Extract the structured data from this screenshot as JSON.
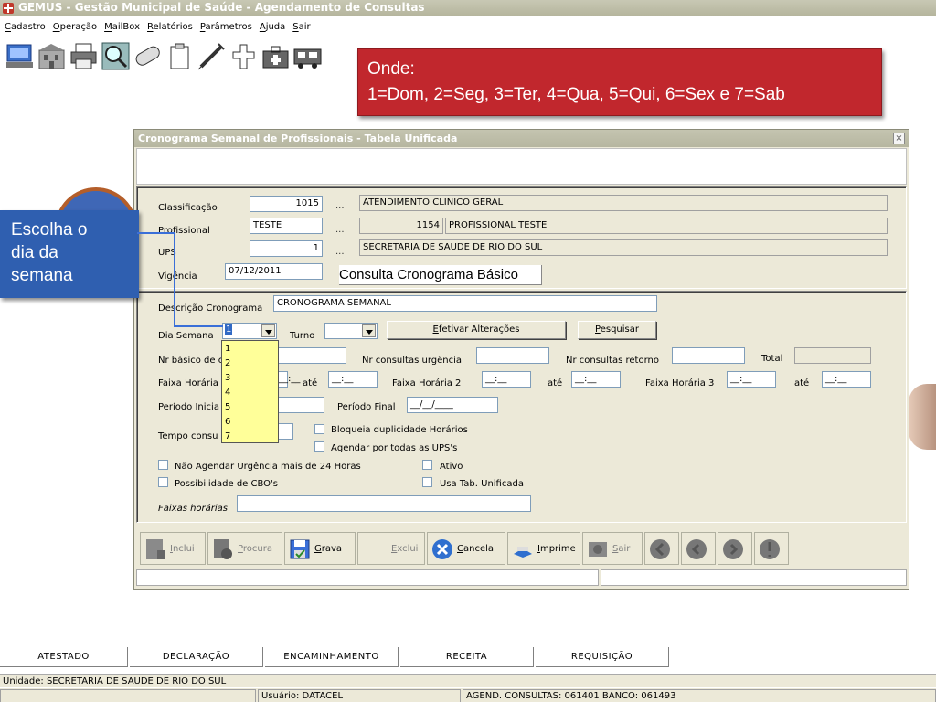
{
  "app": {
    "title": "GEMUS - Gestão Municipal de Saúde - Agendamento de Consultas"
  },
  "menu": {
    "items": [
      {
        "label": "Cadastro",
        "u": "C",
        "rest": "adastro"
      },
      {
        "label": "Operação",
        "u": "O",
        "rest": "peração"
      },
      {
        "label": "MailBox",
        "u": "M",
        "rest": "ailBox"
      },
      {
        "label": "Relatórios",
        "u": "R",
        "rest": "elatórios"
      },
      {
        "label": "Parâmetros",
        "u": "P",
        "rest": "arâmetros"
      },
      {
        "label": "Ajuda",
        "u": "A",
        "rest": "juda"
      },
      {
        "label": "Sair",
        "u": "S",
        "rest": "air"
      }
    ]
  },
  "toolbar": {
    "icons": [
      "computer-icon",
      "building-icon",
      "printer-icon",
      "magnifier-icon",
      "capsule-icon",
      "clipboard-icon",
      "syringe-icon",
      "cross-icon",
      "medkit-icon",
      "ambulance-icon"
    ]
  },
  "callout_red": {
    "line1": "Onde:",
    "line2": "1=Dom, 2=Seg, 3=Ter, 4=Qua, 5=Qui, 6=Sex e 7=Sab"
  },
  "callout_blue": {
    "line1": "Escolha o",
    "line2": "dia da",
    "line3": "semana"
  },
  "dialog": {
    "title": "Cronograma Semanal de Profissionais - Tabela Unificada",
    "close": "×",
    "classificacao": {
      "label": "Classificação",
      "value": "1015",
      "dots": "...",
      "desc": "ATENDIMENTO CLINICO GERAL"
    },
    "profissional": {
      "label": "Profissional",
      "value": "TESTE",
      "dots": "...",
      "code": "1154",
      "desc": "PROFISSIONAL TESTE"
    },
    "ups": {
      "label": "UPS",
      "value": "1",
      "dots": "...",
      "desc": "SECRETARIA DE SAUDE DE RIO DO SUL"
    },
    "vigencia": {
      "label": "Vigência",
      "value": "07/12/2011"
    },
    "consulta_btn": "Consulta Cronograma Básico",
    "descricao": {
      "label": "Descrição Cronograma",
      "value": "CRONOGRAMA SEMANAL"
    },
    "dia_semana": {
      "label": "Dia Semana",
      "value": "1"
    },
    "turno": {
      "label": "Turno",
      "value": ""
    },
    "efetivar_btn": {
      "u": "E",
      "rest": "fetivar Alterações"
    },
    "pesquisar_btn": {
      "u": "P",
      "rest": "esquisar"
    },
    "nr_basico_label": "Nr básico de c",
    "nr_urgencia_label": "Nr consultas urgência",
    "nr_retorno_label": "Nr consultas retorno",
    "total_label": "Total",
    "faixa1_label": "Faixa Horária",
    "ate1": "até",
    "faixa2_label": "Faixa Horária 2",
    "ate2": "até",
    "faixa3_label": "Faixa Horária 3",
    "ate3": "até",
    "time_mask": "__:__",
    "periodo_inicial_label": "Período Inicia",
    "periodo_final_label": "Período Final",
    "date_mask": "__/__/____",
    "tempo_label": "Tempo consu",
    "bloqueia_label": "Bloqueia duplicidade Horários",
    "agendar_label": "Agendar por todas as UPS's",
    "nao_agendar_label": "Não Agendar Urgência mais de 24 Horas",
    "ativo_label": "Ativo",
    "cbo_label": "Possibilidade de CBO's",
    "usa_tab_label": "Usa Tab. Unificada",
    "faixas_label": "Faixas horárias",
    "dropdown_options": [
      "1",
      "2",
      "3",
      "4",
      "5",
      "6",
      "7"
    ]
  },
  "actions": [
    {
      "name": "inclui",
      "u": "I",
      "rest": "nclui",
      "enabled": false
    },
    {
      "name": "procura",
      "u": "P",
      "rest": "rocura",
      "enabled": false
    },
    {
      "name": "grava",
      "u": "G",
      "rest": "rava",
      "enabled": true
    },
    {
      "name": "exclui",
      "u": "E",
      "rest": "xclui",
      "enabled": false
    },
    {
      "name": "cancela",
      "u": "C",
      "rest": "ancela",
      "enabled": true
    },
    {
      "name": "imprime",
      "u": "I",
      "rest": "mprime",
      "enabled": true
    },
    {
      "name": "sair",
      "u": "S",
      "rest": "air",
      "enabled": false
    }
  ],
  "bottom_tabs": [
    "ATESTADO",
    "DECLARAÇÃO",
    "ENCAMINHAMENTO",
    "RECEITA",
    "REQUISIÇÃO"
  ],
  "status": {
    "unidade": "Unidade: SECRETARIA DE SAUDE DE RIO DO SUL",
    "usuario": "Usuário: DATACEL",
    "agend": "AGEND. CONSULTAS: 061401 BANCO: 061493"
  }
}
